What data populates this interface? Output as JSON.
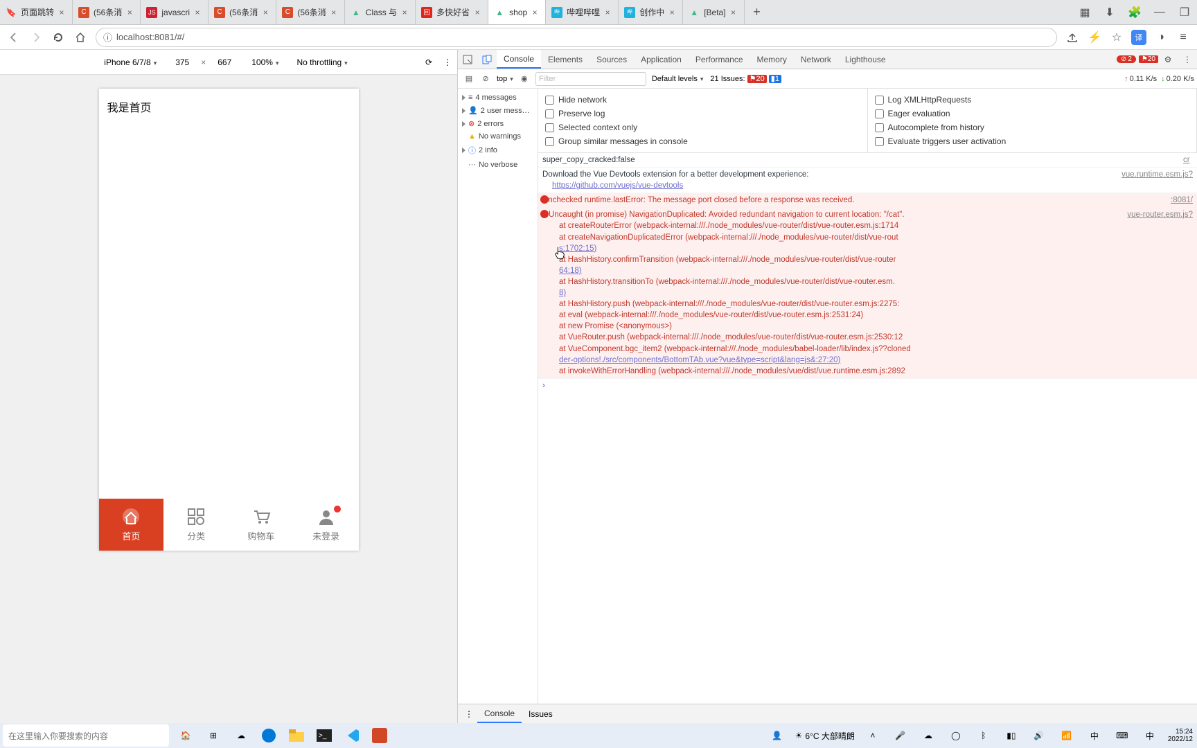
{
  "tabs": [
    {
      "title": "页面跳转",
      "favicon": "csdn"
    },
    {
      "title": "(56条消",
      "favicon": "C"
    },
    {
      "title": "javascri",
      "favicon": "doc"
    },
    {
      "title": "(56条消",
      "favicon": "C"
    },
    {
      "title": "(56条消",
      "favicon": "C"
    },
    {
      "title": "Class 与",
      "favicon": "vue"
    },
    {
      "title": "多快好省",
      "favicon": "jd"
    },
    {
      "title": "shop",
      "favicon": "vue",
      "active": true
    },
    {
      "title": "哔哩哔哩",
      "favicon": "bili"
    },
    {
      "title": "创作中",
      "favicon": "bili"
    },
    {
      "title": "[Beta]",
      "favicon": "vue"
    }
  ],
  "url": "localhost:8081/#/",
  "translate_badge": "译",
  "device": {
    "name": "iPhone 6/7/8",
    "w": "375",
    "h": "667",
    "zoom": "100%",
    "throttle": "No throttling"
  },
  "phone": {
    "header": "我是首页",
    "tabs": [
      {
        "label": "首页",
        "active": true
      },
      {
        "label": "分类"
      },
      {
        "label": "购物车"
      },
      {
        "label": "未登录",
        "dot": true
      }
    ]
  },
  "dtTabs": {
    "list": [
      "Console",
      "Elements",
      "Sources",
      "Application",
      "Performance",
      "Memory",
      "Network",
      "Lighthouse"
    ],
    "active": "Console",
    "errorBadge": "2",
    "flagBadge": "20"
  },
  "consoleToolbar": {
    "context": "top",
    "filter_ph": "Filter",
    "levels": "Default levels",
    "issues": "21 Issues:",
    "issues_break": "20",
    "issues_info": "1",
    "up": "0.11 K/s",
    "down": "0.20 K/s"
  },
  "sidebar": [
    {
      "label": "4 messages",
      "icon": "list"
    },
    {
      "label": "2 user mess…",
      "icon": "user"
    },
    {
      "label": "2 errors",
      "icon": "error"
    },
    {
      "label": "No warnings",
      "icon": "warn"
    },
    {
      "label": "2 info",
      "icon": "info"
    },
    {
      "label": "No verbose",
      "icon": "verbose"
    }
  ],
  "settingsLeft": [
    "Hide network",
    "Preserve log",
    "Selected context only",
    "Group similar messages in console"
  ],
  "settingsRight": [
    "Log XMLHttpRequests",
    "Eager evaluation",
    "Autocomplete from history",
    "Evaluate triggers user activation"
  ],
  "logs": {
    "l1": "super_copy_cracked:false",
    "l1src": "cr",
    "l2a": "Download the Vue Devtools extension for a better development experience:",
    "l2b": "https://github.com/vuejs/vue-devtools",
    "l2src": "vue.runtime.esm.js?",
    "l3": "Unchecked runtime.lastError: The message port closed before a response was received.",
    "l3src": ":8081/",
    "l4a": "Uncaught (in promise) NavigationDuplicated: Avoided redundant navigation to current location: \"/cat\".",
    "l4src": "vue-router.esm.js?",
    "s1": "at createRouterError (webpack-internal:///./node_modules/vue-router/dist/vue-router.esm.js:1714",
    "s2": "at createNavigationDuplicatedError (webpack-internal:///./node_modules/vue-router/dist/vue-rout",
    "s2b": "s:1702:15)",
    "s3": "at HashHistory.confirmTransition (webpack-internal:///./node_modules/vue-router/dist/vue-router",
    "s3b": "64:18)",
    "s4": "at HashHistory.transitionTo (webpack-internal:///./node_modules/vue-router/dist/vue-router.esm.",
    "s4b": "8)",
    "s5": "at HashHistory.push (webpack-internal:///./node_modules/vue-router/dist/vue-router.esm.js:2275:",
    "s6": "at eval (webpack-internal:///./node_modules/vue-router/dist/vue-router.esm.js:2531:24)",
    "s7": "at new Promise (<anonymous>)",
    "s8": "at VueRouter.push (webpack-internal:///./node_modules/vue-router/dist/vue-router.esm.js:2530:12",
    "s9": "at VueComponent.bgc_item2 (webpack-internal:///./node_modules/babel-loader/lib/index.js??cloned",
    "s9b": "der-options!./src/components/BottomTAb.vue?vue&type=script&lang=js&:27:20)",
    "s10": "at invokeWithErrorHandling (webpack-internal:///./node_modules/vue/dist/vue.runtime.esm.js:2892"
  },
  "drawer": {
    "tabs": [
      "Console",
      "Issues"
    ],
    "active": "Console"
  },
  "taskbar": {
    "search_ph": "在这里输入你要搜索的内容",
    "weather": "6°C 大部晴朗",
    "ime": "中",
    "time": "15:24",
    "date": "2022/12"
  }
}
